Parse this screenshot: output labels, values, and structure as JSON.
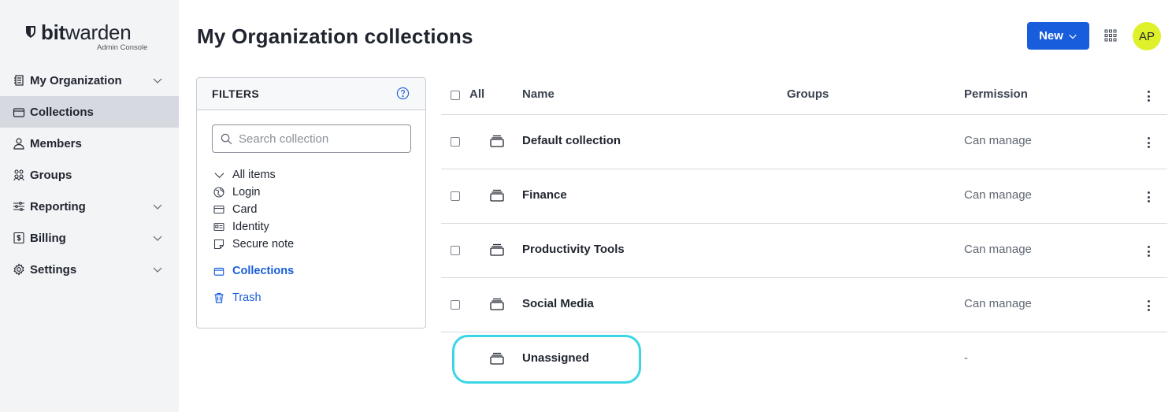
{
  "brand": {
    "name_bold": "bit",
    "name_rest": "warden",
    "subtitle": "Admin Console"
  },
  "sidebar": {
    "items": [
      {
        "label": "My Organization",
        "icon": "organization-icon",
        "expandable": true,
        "active": false
      },
      {
        "label": "Collections",
        "icon": "collection-icon",
        "expandable": false,
        "active": true
      },
      {
        "label": "Members",
        "icon": "user-icon",
        "expandable": false,
        "active": false
      },
      {
        "label": "Groups",
        "icon": "users-icon",
        "expandable": false,
        "active": false
      },
      {
        "label": "Reporting",
        "icon": "sliders-icon",
        "expandable": true,
        "active": false
      },
      {
        "label": "Billing",
        "icon": "billing-icon",
        "expandable": true,
        "active": false
      },
      {
        "label": "Settings",
        "icon": "gear-icon",
        "expandable": true,
        "active": false
      }
    ]
  },
  "header": {
    "title": "My Organization collections",
    "new_button": "New",
    "avatar_initials": "AP",
    "colors": {
      "accent": "#175ddc",
      "avatar": "#dff12a"
    }
  },
  "filters": {
    "title": "FILTERS",
    "search_placeholder": "Search collection",
    "all_items": "All items",
    "types": [
      {
        "label": "Login",
        "icon": "globe-icon"
      },
      {
        "label": "Card",
        "icon": "credit-card-icon"
      },
      {
        "label": "Identity",
        "icon": "id-card-icon"
      },
      {
        "label": "Secure note",
        "icon": "sticky-note-icon"
      }
    ],
    "collections_label": "Collections",
    "trash_label": "Trash"
  },
  "table": {
    "headers": {
      "all": "All",
      "name": "Name",
      "groups": "Groups",
      "permission": "Permission"
    },
    "rows": [
      {
        "name": "Default collection",
        "groups": "",
        "permission": "Can manage"
      },
      {
        "name": "Finance",
        "groups": "",
        "permission": "Can manage"
      },
      {
        "name": "Productivity Tools",
        "groups": "",
        "permission": "Can manage"
      },
      {
        "name": "Social Media",
        "groups": "",
        "permission": "Can manage"
      },
      {
        "name": "Unassigned",
        "groups": "",
        "permission": "-"
      }
    ]
  }
}
